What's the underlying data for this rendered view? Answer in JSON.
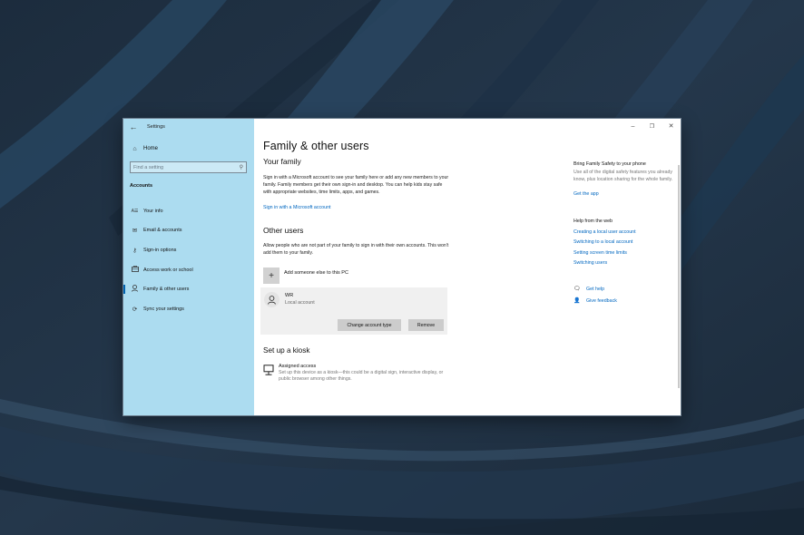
{
  "window": {
    "app_title": "Settings",
    "controls": {
      "minimize": "–",
      "maximize": "❐",
      "close": "✕"
    }
  },
  "sidebar": {
    "home_label": "Home",
    "search_placeholder": "Find a setting",
    "section_label": "Accounts",
    "items": [
      {
        "label": "Your info",
        "icon": "your-info-icon",
        "glyph": "A☰",
        "active": false
      },
      {
        "label": "Email & accounts",
        "icon": "mail-icon",
        "glyph": "✉",
        "active": false
      },
      {
        "label": "Sign-in options",
        "icon": "key-icon",
        "glyph": "⚷",
        "active": false
      },
      {
        "label": "Access work or school",
        "icon": "briefcase-icon",
        "glyph": "💼",
        "active": false
      },
      {
        "label": "Family & other users",
        "icon": "person-icon",
        "glyph": "⍝",
        "active": true
      },
      {
        "label": "Sync your settings",
        "icon": "sync-icon",
        "glyph": "⟳",
        "active": false
      }
    ]
  },
  "main": {
    "title": "Family & other users",
    "your_family": {
      "heading": "Your family",
      "description": "Sign in with a Microsoft account to see your family here or add any new members to your family. Family members get their own sign-in and desktop. You can help kids stay safe with appropriate websites, time limits, apps, and games.",
      "link": "Sign in with a Microsoft account"
    },
    "other_users": {
      "heading": "Other users",
      "description": "Allow people who are not part of your family to sign in with their own accounts. This won't add them to your family.",
      "add_label": "Add someone else to this PC",
      "users": [
        {
          "name": "WR",
          "type": "Local account"
        }
      ],
      "change_button": "Change account type",
      "remove_button": "Remove"
    },
    "kiosk": {
      "heading": "Set up a kiosk",
      "item_title": "Assigned access",
      "item_description": "Set up this device as a kiosk—this could be a digital sign, interactive display, or public browser among other things."
    }
  },
  "aside": {
    "family_safety": {
      "heading": "Bring Family Safety to your phone",
      "description": "Use all of the digital safety features you already know, plus location sharing for the whole family.",
      "link": "Get the app"
    },
    "help": {
      "heading": "Help from the web",
      "links": [
        "Creating a local user account",
        "Switching to a local account",
        "Setting screen time limits",
        "Switching users"
      ]
    },
    "support": {
      "get_help": "Get help",
      "give_feedback": "Give feedback"
    }
  },
  "colors": {
    "sidebar_bg": "#acdcf0",
    "accent": "#0063b1",
    "link": "#0067c0",
    "wallpaper": "#1f2f40"
  }
}
